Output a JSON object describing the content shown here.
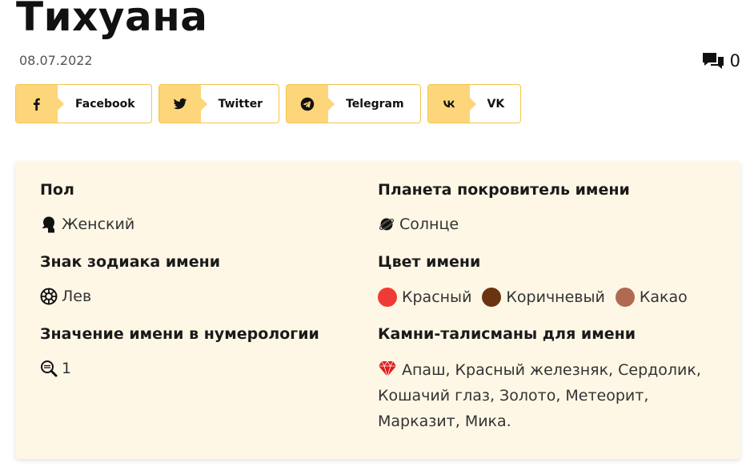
{
  "title": "Тихуана",
  "date": "08.07.2022",
  "comments_count": "0",
  "share": [
    {
      "label": "Facebook",
      "icon": "facebook-icon"
    },
    {
      "label": "Twitter",
      "icon": "twitter-icon"
    },
    {
      "label": "Telegram",
      "icon": "telegram-icon"
    },
    {
      "label": "VK",
      "icon": "vk-icon"
    }
  ],
  "info": {
    "gender_heading": "Пол",
    "gender_value": "Женский",
    "zodiac_heading": "Знак зодиака имени",
    "zodiac_value": "Лев",
    "numerology_heading": "Значение имени в нумерологии",
    "numerology_value": "1",
    "planet_heading": "Планета покровитель имени",
    "planet_value": "Солнце",
    "color_heading": "Цвет имени",
    "colors": [
      {
        "name": "Красный",
        "hex": "#ef3b36"
      },
      {
        "name": "Коричневый",
        "hex": "#6b3410"
      },
      {
        "name": "Какао",
        "hex": "#b06a52"
      }
    ],
    "stones_heading": "Камни-талисманы для имени",
    "stones_value": "Апаш, Красный железняк, Сердолик, Кошачий глаз, Золото, Метеорит, Марказит, Мика."
  },
  "accent_colors": {
    "share_icon_bg": "#fdd57a",
    "share_border": "#f2c54d",
    "card_bg": "#fff7e6"
  }
}
